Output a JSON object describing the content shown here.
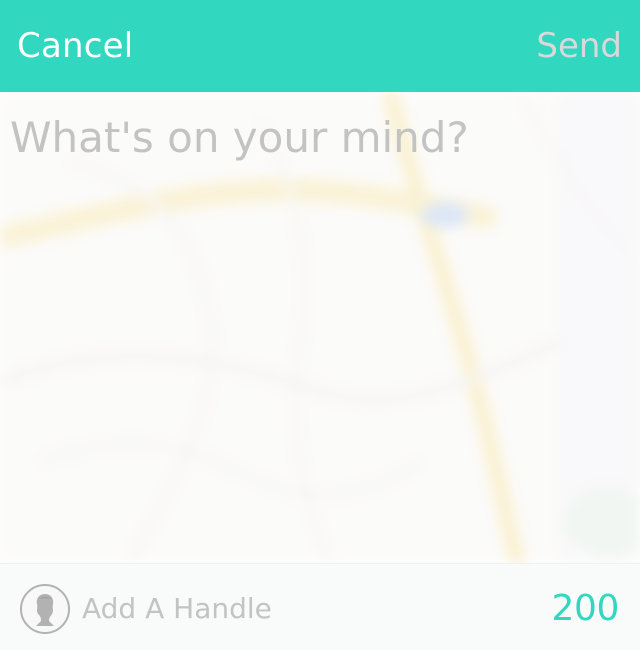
{
  "header": {
    "cancel_label": "Cancel",
    "send_label": "Send",
    "background_color": "#31d8bf",
    "send_color": "#d9d9d9"
  },
  "composer": {
    "placeholder": "What's on your mind?",
    "value": "",
    "background": "map-blur"
  },
  "footer": {
    "handle_label": "Add A Handle",
    "avatar_icon": "user-silhouette-icon",
    "character_count": "200",
    "accent_color": "#31d8bf"
  }
}
